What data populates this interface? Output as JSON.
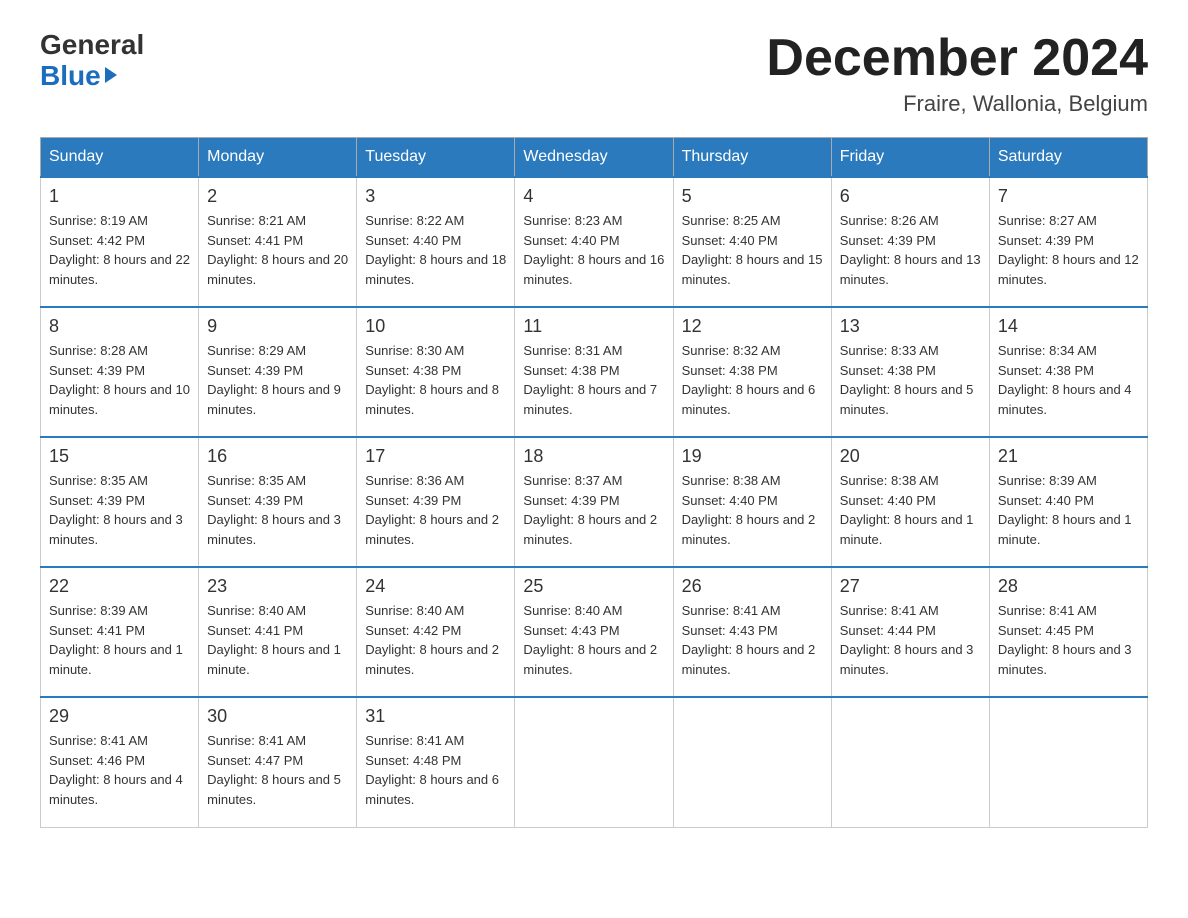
{
  "logo": {
    "general": "General",
    "blue": "Blue"
  },
  "header": {
    "month": "December 2024",
    "location": "Fraire, Wallonia, Belgium"
  },
  "days_of_week": [
    "Sunday",
    "Monday",
    "Tuesday",
    "Wednesday",
    "Thursday",
    "Friday",
    "Saturday"
  ],
  "weeks": [
    [
      {
        "day": "1",
        "sunrise": "8:19 AM",
        "sunset": "4:42 PM",
        "daylight": "8 hours and 22 minutes."
      },
      {
        "day": "2",
        "sunrise": "8:21 AM",
        "sunset": "4:41 PM",
        "daylight": "8 hours and 20 minutes."
      },
      {
        "day": "3",
        "sunrise": "8:22 AM",
        "sunset": "4:40 PM",
        "daylight": "8 hours and 18 minutes."
      },
      {
        "day": "4",
        "sunrise": "8:23 AM",
        "sunset": "4:40 PM",
        "daylight": "8 hours and 16 minutes."
      },
      {
        "day": "5",
        "sunrise": "8:25 AM",
        "sunset": "4:40 PM",
        "daylight": "8 hours and 15 minutes."
      },
      {
        "day": "6",
        "sunrise": "8:26 AM",
        "sunset": "4:39 PM",
        "daylight": "8 hours and 13 minutes."
      },
      {
        "day": "7",
        "sunrise": "8:27 AM",
        "sunset": "4:39 PM",
        "daylight": "8 hours and 12 minutes."
      }
    ],
    [
      {
        "day": "8",
        "sunrise": "8:28 AM",
        "sunset": "4:39 PM",
        "daylight": "8 hours and 10 minutes."
      },
      {
        "day": "9",
        "sunrise": "8:29 AM",
        "sunset": "4:39 PM",
        "daylight": "8 hours and 9 minutes."
      },
      {
        "day": "10",
        "sunrise": "8:30 AM",
        "sunset": "4:38 PM",
        "daylight": "8 hours and 8 minutes."
      },
      {
        "day": "11",
        "sunrise": "8:31 AM",
        "sunset": "4:38 PM",
        "daylight": "8 hours and 7 minutes."
      },
      {
        "day": "12",
        "sunrise": "8:32 AM",
        "sunset": "4:38 PM",
        "daylight": "8 hours and 6 minutes."
      },
      {
        "day": "13",
        "sunrise": "8:33 AM",
        "sunset": "4:38 PM",
        "daylight": "8 hours and 5 minutes."
      },
      {
        "day": "14",
        "sunrise": "8:34 AM",
        "sunset": "4:38 PM",
        "daylight": "8 hours and 4 minutes."
      }
    ],
    [
      {
        "day": "15",
        "sunrise": "8:35 AM",
        "sunset": "4:39 PM",
        "daylight": "8 hours and 3 minutes."
      },
      {
        "day": "16",
        "sunrise": "8:35 AM",
        "sunset": "4:39 PM",
        "daylight": "8 hours and 3 minutes."
      },
      {
        "day": "17",
        "sunrise": "8:36 AM",
        "sunset": "4:39 PM",
        "daylight": "8 hours and 2 minutes."
      },
      {
        "day": "18",
        "sunrise": "8:37 AM",
        "sunset": "4:39 PM",
        "daylight": "8 hours and 2 minutes."
      },
      {
        "day": "19",
        "sunrise": "8:38 AM",
        "sunset": "4:40 PM",
        "daylight": "8 hours and 2 minutes."
      },
      {
        "day": "20",
        "sunrise": "8:38 AM",
        "sunset": "4:40 PM",
        "daylight": "8 hours and 1 minute."
      },
      {
        "day": "21",
        "sunrise": "8:39 AM",
        "sunset": "4:40 PM",
        "daylight": "8 hours and 1 minute."
      }
    ],
    [
      {
        "day": "22",
        "sunrise": "8:39 AM",
        "sunset": "4:41 PM",
        "daylight": "8 hours and 1 minute."
      },
      {
        "day": "23",
        "sunrise": "8:40 AM",
        "sunset": "4:41 PM",
        "daylight": "8 hours and 1 minute."
      },
      {
        "day": "24",
        "sunrise": "8:40 AM",
        "sunset": "4:42 PM",
        "daylight": "8 hours and 2 minutes."
      },
      {
        "day": "25",
        "sunrise": "8:40 AM",
        "sunset": "4:43 PM",
        "daylight": "8 hours and 2 minutes."
      },
      {
        "day": "26",
        "sunrise": "8:41 AM",
        "sunset": "4:43 PM",
        "daylight": "8 hours and 2 minutes."
      },
      {
        "day": "27",
        "sunrise": "8:41 AM",
        "sunset": "4:44 PM",
        "daylight": "8 hours and 3 minutes."
      },
      {
        "day": "28",
        "sunrise": "8:41 AM",
        "sunset": "4:45 PM",
        "daylight": "8 hours and 3 minutes."
      }
    ],
    [
      {
        "day": "29",
        "sunrise": "8:41 AM",
        "sunset": "4:46 PM",
        "daylight": "8 hours and 4 minutes."
      },
      {
        "day": "30",
        "sunrise": "8:41 AM",
        "sunset": "4:47 PM",
        "daylight": "8 hours and 5 minutes."
      },
      {
        "day": "31",
        "sunrise": "8:41 AM",
        "sunset": "4:48 PM",
        "daylight": "8 hours and 6 minutes."
      },
      null,
      null,
      null,
      null
    ]
  ],
  "labels": {
    "sunrise": "Sunrise:",
    "sunset": "Sunset:",
    "daylight": "Daylight:"
  }
}
